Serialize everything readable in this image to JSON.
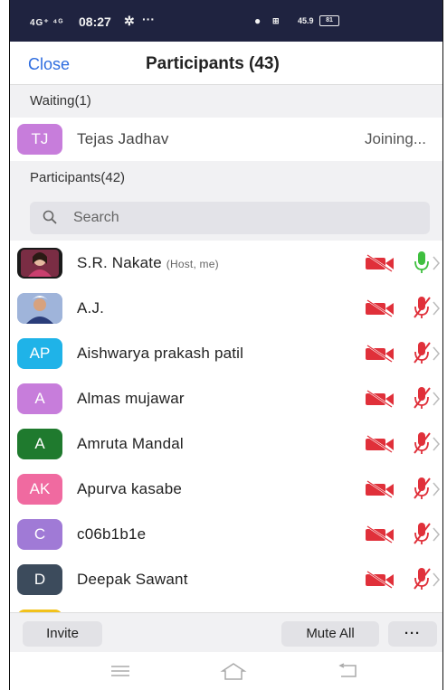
{
  "status_bar": {
    "signal": "4G⁺ ⁴ᴳ",
    "time": "08:27",
    "more": "···",
    "net_speed": "45.9",
    "battery": "81"
  },
  "header": {
    "close_label": "Close",
    "title": "Participants (43)"
  },
  "waiting": {
    "label": "Waiting(1)",
    "items": [
      {
        "initials": "TJ",
        "name": "Tejas Jadhav",
        "status": "Joining...",
        "color": "#c77ddb"
      }
    ]
  },
  "participants": {
    "label": "Participants(42)",
    "search_placeholder": "Search",
    "items": [
      {
        "initials": "",
        "name": "S.R. Nakate",
        "role": "(Host, me)",
        "avatar": "photo-woman",
        "color": "#6b2b3a",
        "mic": "on"
      },
      {
        "initials": "",
        "name": "A.J.",
        "role": "",
        "avatar": "photo-cartoon",
        "color": "#8aa0c8",
        "mic": "muted"
      },
      {
        "initials": "AP",
        "name": "Aishwarya prakash patil",
        "role": "",
        "color": "#1fb3e8",
        "mic": "muted"
      },
      {
        "initials": "A",
        "name": "Almas  mujawar",
        "role": "",
        "color": "#c77ddb",
        "mic": "muted"
      },
      {
        "initials": "A",
        "name": "Amruta Mandal",
        "role": "",
        "color": "#1f7a2e",
        "mic": "muted"
      },
      {
        "initials": "AK",
        "name": "Apurva kasabe",
        "role": "",
        "color": "#f06aa0",
        "mic": "muted"
      },
      {
        "initials": "C",
        "name": "c06b1b1e",
        "role": "",
        "color": "#a07ad6",
        "mic": "muted"
      },
      {
        "initials": "D",
        "name": "Deepak Sawant",
        "role": "",
        "color": "#3c4b5c",
        "mic": "muted"
      }
    ]
  },
  "footer": {
    "invite_label": "Invite",
    "mute_all_label": "Mute All",
    "more_label": "···"
  },
  "colors": {
    "accent": "#2d6cdf",
    "muted_red": "#e0303a",
    "mic_on_green": "#3fbf3f",
    "statusbar": "#1f2340"
  }
}
